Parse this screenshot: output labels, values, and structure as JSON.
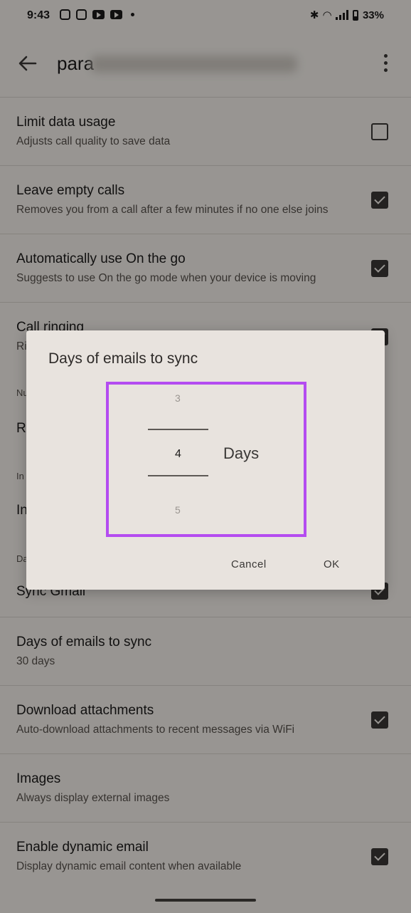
{
  "status": {
    "time": "9:43",
    "battery": "33%"
  },
  "appbar": {
    "title_prefix": "para"
  },
  "settings": {
    "limit_data": {
      "title": "Limit data usage",
      "subtitle": "Adjusts call quality to save data",
      "checked": false
    },
    "leave_empty": {
      "title": "Leave empty calls",
      "subtitle": "Removes you from a call after a few minutes if no one else joins",
      "checked": true
    },
    "on_the_go": {
      "title": "Automatically use On the go",
      "subtitle": "Suggests to use On the go mode when your device is moving",
      "checked": true
    },
    "call_ringing": {
      "title": "Call ringing",
      "subtitle": "Ri",
      "checked": true
    },
    "section_n": "Nu",
    "row_r": "Re",
    "section_i": "In",
    "row_i": "In",
    "section_d": "Da",
    "sync_gmail": {
      "title": "Sync Gmail",
      "checked": true
    },
    "days_sync": {
      "title": "Days of emails to sync",
      "subtitle": "30 days"
    },
    "download": {
      "title": "Download attachments",
      "subtitle": "Auto-download attachments to recent messages via WiFi",
      "checked": true
    },
    "images": {
      "title": "Images",
      "subtitle": "Always display external images"
    },
    "dynamic": {
      "title": "Enable dynamic email",
      "subtitle": "Display dynamic email content when available",
      "checked": true
    }
  },
  "dialog": {
    "title": "Days of emails to sync",
    "picker_prev": "3",
    "picker_current": "4",
    "picker_next": "5",
    "unit": "Days",
    "cancel": "Cancel",
    "ok": "OK",
    "highlight_color": "#b44cf0"
  }
}
